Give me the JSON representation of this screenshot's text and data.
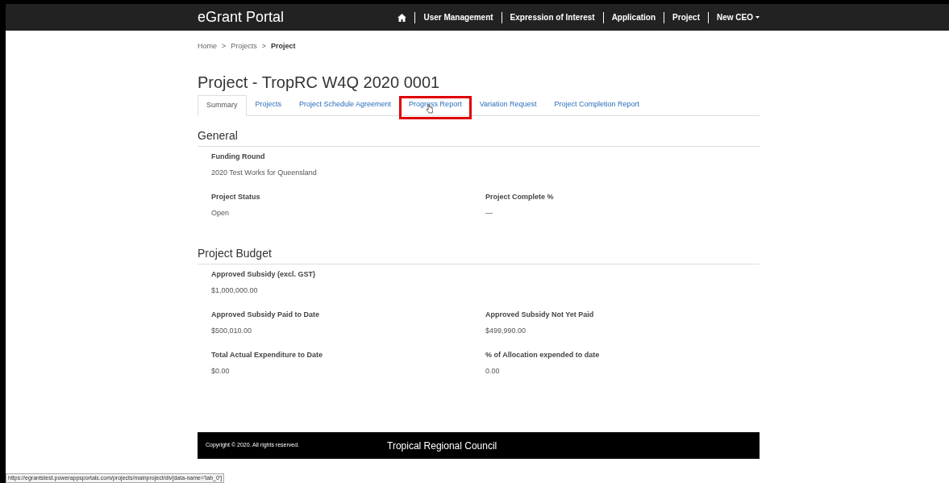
{
  "navbar": {
    "brand": "eGrant Portal",
    "items": [
      {
        "kind": "home"
      },
      {
        "kind": "link",
        "label": "User Management"
      },
      {
        "kind": "link",
        "label": "Expression of Interest"
      },
      {
        "kind": "link",
        "label": "Application"
      },
      {
        "kind": "link",
        "label": "Project"
      },
      {
        "kind": "dropdown",
        "label": "New CEO"
      }
    ]
  },
  "breadcrumb": [
    {
      "label": "Home",
      "current": false
    },
    {
      "label": "Projects",
      "current": false
    },
    {
      "label": "Project",
      "current": true
    }
  ],
  "breadcrumb_separator": ">",
  "title": "Project - TropRC W4Q 2020 0001",
  "tabs": [
    {
      "label": "Summary",
      "selected": true,
      "highlighted": false
    },
    {
      "label": "Projects",
      "selected": false,
      "highlighted": false
    },
    {
      "label": "Project Schedule Agreement",
      "selected": false,
      "highlighted": false
    },
    {
      "label": "Progress Report",
      "selected": false,
      "highlighted": true
    },
    {
      "label": "Variation Request",
      "selected": false,
      "highlighted": false
    },
    {
      "label": "Project Completion Report",
      "selected": false,
      "highlighted": false
    }
  ],
  "sections": [
    {
      "heading": "General",
      "rows": [
        [
          {
            "label": "Funding Round",
            "value": "2020 Test Works for Queensland"
          }
        ],
        [
          {
            "label": "Project Status",
            "value": "Open"
          },
          {
            "label": "Project Complete %",
            "value": "—"
          }
        ]
      ]
    },
    {
      "heading": "Project Budget",
      "rows": [
        [
          {
            "label": "Approved Subsidy (excl. GST)",
            "value": "$1,000,000.00"
          }
        ],
        [
          {
            "label": "Approved Subsidy Paid to Date",
            "value": "$500,010.00"
          },
          {
            "label": "Approved Subsidy Not Yet Paid",
            "value": "$499,990.00"
          }
        ],
        [
          {
            "label": "Total Actual Expenditure to Date",
            "value": "$0.00"
          },
          {
            "label": "% of Allocation expended to date",
            "value": "0.00"
          }
        ]
      ]
    }
  ],
  "footer": {
    "copyright": "Copyright © 2020. All rights reserved.",
    "organisation": "Tropical Regional Council"
  },
  "status_url": "https://egrantstest.powerappsportals.com/projects/mainproject/div[data-name='tab_0']"
}
